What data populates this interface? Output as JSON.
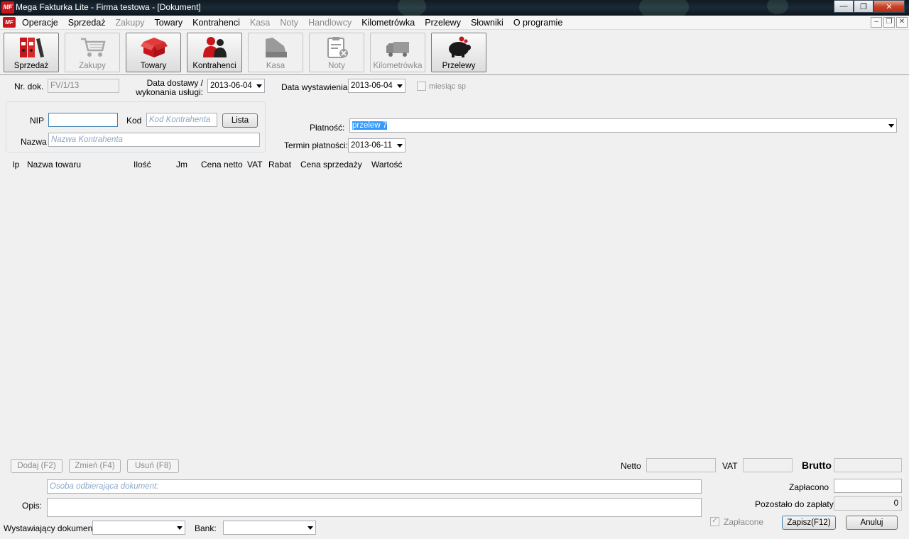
{
  "window": {
    "title": "Mega Fakturka Lite - Firma testowa - [Dokument]",
    "app_icon": "MF"
  },
  "menu": {
    "items": [
      {
        "label": "Operacje",
        "enabled": true
      },
      {
        "label": "Sprzedaż",
        "enabled": true
      },
      {
        "label": "Zakupy",
        "enabled": false
      },
      {
        "label": "Towary",
        "enabled": true
      },
      {
        "label": "Kontrahenci",
        "enabled": true
      },
      {
        "label": "Kasa",
        "enabled": false
      },
      {
        "label": "Noty",
        "enabled": false
      },
      {
        "label": "Handlowcy",
        "enabled": false
      },
      {
        "label": "Kilometrówka",
        "enabled": true
      },
      {
        "label": "Przelewy",
        "enabled": true
      },
      {
        "label": "Słowniki",
        "enabled": true
      },
      {
        "label": "O programie",
        "enabled": true
      }
    ]
  },
  "toolbar": {
    "buttons": [
      {
        "label": "Sprzedaż",
        "icon": "binders-icon",
        "enabled": true
      },
      {
        "label": "Zakupy",
        "icon": "cart-icon",
        "enabled": false
      },
      {
        "label": "Towary",
        "icon": "box-icon",
        "enabled": true
      },
      {
        "label": "Kontrahenci",
        "icon": "people-icon",
        "enabled": true
      },
      {
        "label": "Kasa",
        "icon": "cash-register-icon",
        "enabled": false
      },
      {
        "label": "Noty",
        "icon": "note-icon",
        "enabled": false
      },
      {
        "label": "Kilometrówka",
        "icon": "truck-icon",
        "enabled": false
      },
      {
        "label": "Przelewy",
        "icon": "piggy-bank-icon",
        "enabled": true
      }
    ]
  },
  "form": {
    "nr_dok_label": "Nr. dok.",
    "nr_dok_value": "FV/1/13",
    "data_dostawy_label_1": "Data dostawy /",
    "data_dostawy_label_2": "wykonania usługi:",
    "data_dostawy_value": "2013-06-04",
    "data_wystawienia_label": "Data wystawienia:",
    "data_wystawienia_value": "2013-06-04",
    "miesiac_label": "miesiąc sp",
    "nip_label": "NIP",
    "nip_value": "",
    "kod_label": "Kod",
    "kod_placeholder": "Kod Kontrahenta",
    "lista_button": "Lista",
    "nazwa_label": "Nazwa",
    "nazwa_placeholder": "Nazwa Kontrahenta",
    "platnosc_label": "Płatność:",
    "platnosc_value": "przelew 7",
    "termin_label": "Termin płatności:",
    "termin_value": "2013-06-11"
  },
  "table": {
    "columns": [
      "lp",
      "Nazwa towaru",
      "Ilość",
      "Jm",
      "Cena netto",
      "VAT",
      "Rabat",
      "Cena sprzedaży",
      "Wartość"
    ],
    "rows": []
  },
  "bottom": {
    "dodaj_button": "Dodaj (F2)",
    "zmien_button": "Zmień (F4)",
    "usun_button": "Usuń (F8)",
    "netto_label": "Netto",
    "netto_value": "",
    "vat_label": "VAT",
    "vat_value": "",
    "brutto_label": "Brutto",
    "brutto_value": "",
    "osoba_placeholder": "Osoba odbierająca dokument:",
    "opis_label": "Opis:",
    "opis_value": "",
    "zaplacono_label": "Zapłacono",
    "zaplacono_value": "",
    "pozostalo_label": "Pozostało do zapłaty",
    "pozostalo_value": "0",
    "wystawiajacy_label": "Wystawiający dokument",
    "wystawiajacy_value": "",
    "bank_label": "Bank:",
    "bank_value": "",
    "zaplacone_label": "Zapłacone",
    "zapisz_button": "Zapisz(F12)",
    "anuluj_button": "Anuluj"
  }
}
